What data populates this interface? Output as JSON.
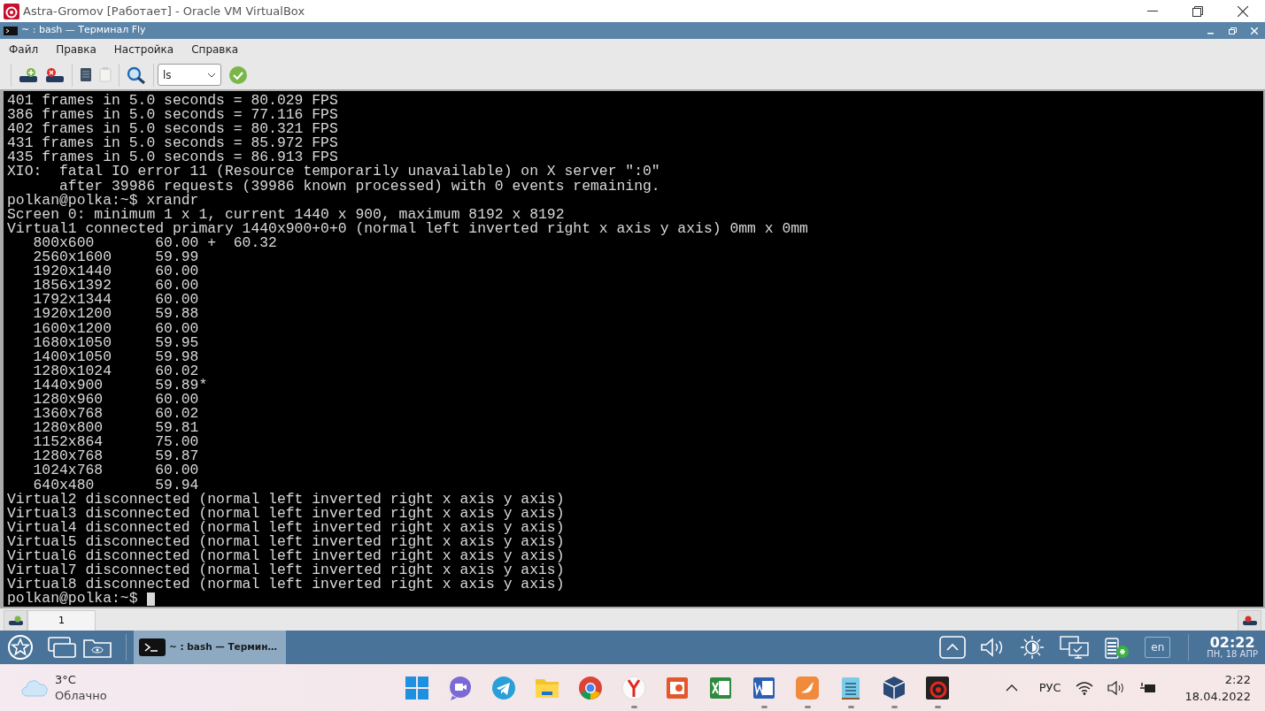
{
  "host_window": {
    "title": "Astra-Gromov [Работает] - Oracle VM VirtualBox"
  },
  "terminal_window": {
    "title": "~ : bash — Терминал Fly"
  },
  "menu": [
    "Файл",
    "Правка",
    "Настройка",
    "Справка"
  ],
  "toolbar": {
    "command_value": "ls"
  },
  "terminal_lines": [
    "401 frames in 5.0 seconds = 80.029 FPS",
    "386 frames in 5.0 seconds = 77.116 FPS",
    "402 frames in 5.0 seconds = 80.321 FPS",
    "431 frames in 5.0 seconds = 85.972 FPS",
    "435 frames in 5.0 seconds = 86.913 FPS",
    "XIO:  fatal IO error 11 (Resource temporarily unavailable) on X server \":0\"",
    "      after 39986 requests (39986 known processed) with 0 events remaining.",
    "polkan@polka:~$ xrandr",
    "Screen 0: minimum 1 x 1, current 1440 x 900, maximum 8192 x 8192",
    "Virtual1 connected primary 1440x900+0+0 (normal left inverted right x axis y axis) 0mm x 0mm",
    "   800x600       60.00 +  60.32",
    "   2560x1600     59.99",
    "   1920x1440     60.00",
    "   1856x1392     60.00",
    "   1792x1344     60.00",
    "   1920x1200     59.88",
    "   1600x1200     60.00",
    "   1680x1050     59.95",
    "   1400x1050     59.98",
    "   1280x1024     60.02",
    "   1440x900      59.89*",
    "   1280x960      60.00",
    "   1360x768      60.02",
    "   1280x800      59.81",
    "   1152x864      75.00",
    "   1280x768      59.87",
    "   1024x768      60.00",
    "   640x480       59.94",
    "Virtual2 disconnected (normal left inverted right x axis y axis)",
    "Virtual3 disconnected (normal left inverted right x axis y axis)",
    "Virtual4 disconnected (normal left inverted right x axis y axis)",
    "Virtual5 disconnected (normal left inverted right x axis y axis)",
    "Virtual6 disconnected (normal left inverted right x axis y axis)",
    "Virtual7 disconnected (normal left inverted right x axis y axis)",
    "Virtual8 disconnected (normal left inverted right x axis y axis)"
  ],
  "prompt": "polkan@polka:~$",
  "terminal_tabs": [
    {
      "label": "1",
      "selected": true
    }
  ],
  "astra_panel": {
    "task": "~ : bash — Термин…",
    "layout": "en",
    "time": "02:22",
    "date": "ПН, 18 АПР"
  },
  "windows_taskbar": {
    "temperature": "3°C",
    "weather": "Облачно",
    "apps": [
      {
        "kind": "start",
        "running": false
      },
      {
        "kind": "chat",
        "running": false
      },
      {
        "kind": "telegram",
        "running": false
      },
      {
        "kind": "folder",
        "running": false
      },
      {
        "kind": "chrome",
        "running": false
      },
      {
        "kind": "yandex",
        "running": true
      },
      {
        "kind": "powerpoint",
        "running": false
      },
      {
        "kind": "excel",
        "running": false
      },
      {
        "kind": "word",
        "running": true
      },
      {
        "kind": "pinta",
        "running": true
      },
      {
        "kind": "notepad",
        "running": true
      },
      {
        "kind": "virtualbox",
        "running": true
      },
      {
        "kind": "astra",
        "running": true
      }
    ],
    "language": "РУС",
    "time": "2:22",
    "date": "18.04.2022"
  }
}
